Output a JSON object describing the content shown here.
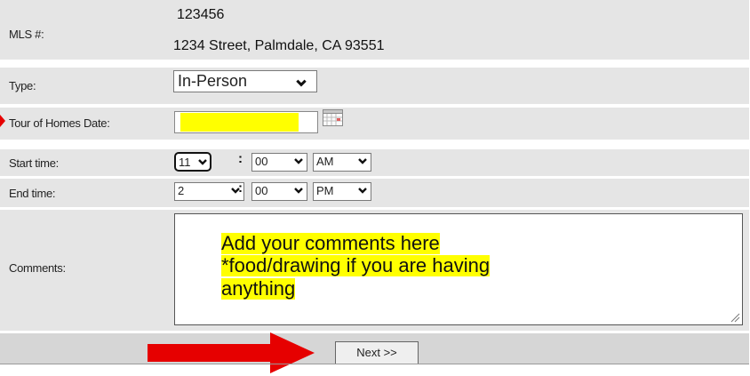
{
  "form": {
    "mls_label": "MLS #:",
    "mls_number": "123456",
    "address": "1234 Street, Palmdale, CA 93551",
    "type_label": "Type:",
    "type_value": "In-Person",
    "date_label": "Tour of Homes Date:",
    "date_value": "",
    "start_label": "Start time:",
    "start_hour": "11",
    "start_minute": "00",
    "start_ampm": "AM",
    "end_label": "End time:",
    "end_hour": "2",
    "end_minute": "00",
    "end_ampm": "PM",
    "time_separator": ":",
    "comments_label": "Comments:",
    "comments_lines": [
      "Add your comments here",
      "*food/drawing if you are having",
      "anything"
    ],
    "next_label": "Next >>"
  },
  "colors": {
    "highlight": "#ffff00",
    "arrow": "#e60000",
    "row_background": "#e5e5e5"
  }
}
